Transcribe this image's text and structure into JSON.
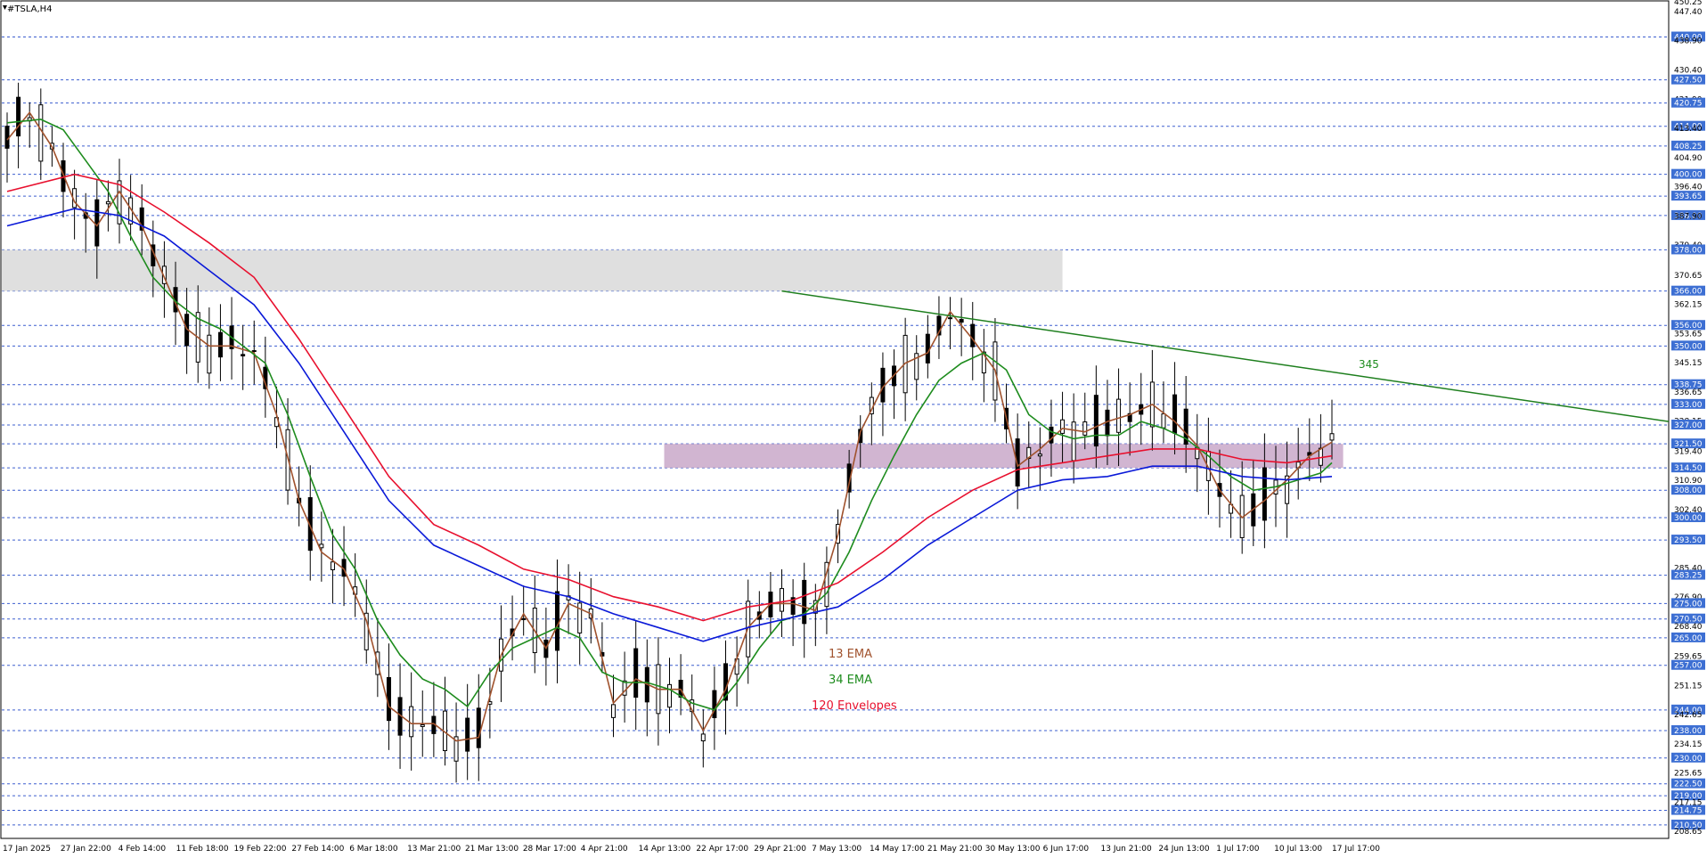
{
  "window_title": "#TSLA,H4",
  "chart_data": {
    "type": "candlestick",
    "symbol": "#TSLA",
    "timeframe": "H4",
    "ylim": [
      206.85,
      450.25
    ],
    "grid": true,
    "x_ticks": [
      "17 Jan 2025",
      "27 Jan 22:00",
      "4 Feb 14:00",
      "11 Feb 18:00",
      "19 Feb 22:00",
      "27 Feb 14:00",
      "6 Mar 18:00",
      "13 Mar 21:00",
      "21 Mar 13:00",
      "28 Mar 17:00",
      "4 Apr 21:00",
      "14 Apr 13:00",
      "22 Apr 17:00",
      "29 Apr 21:00",
      "7 May 13:00",
      "14 May 17:00",
      "21 May 21:00",
      "30 May 13:00",
      "6 Jun 17:00",
      "13 Jun 21:00",
      "24 Jun 13:00",
      "1 Jul 17:00",
      "10 Jul 13:00",
      "17 Jul 17:00"
    ],
    "y_ticks": [
      "450.25",
      "447.40",
      "440.00",
      "438.90",
      "430.40",
      "427.50",
      "421.90",
      "420.75",
      "414.00",
      "413.40",
      "408.25",
      "404.90",
      "400.00",
      "396.40",
      "393.65",
      "388.00",
      "387.90",
      "379.40",
      "378.00",
      "370.65",
      "366.00",
      "362.15",
      "356.00",
      "353.65",
      "350.00",
      "345.15",
      "338.75",
      "336.65",
      "333.00",
      "328.15",
      "327.00",
      "321.50",
      "319.40",
      "314.50",
      "310.90",
      "308.00",
      "302.40",
      "300.00",
      "293.90",
      "293.50",
      "285.40",
      "283.25",
      "276.90",
      "275.00",
      "270.50",
      "268.40",
      "265.00",
      "259.65",
      "257.00",
      "251.15",
      "244.00",
      "242.65",
      "238.00",
      "234.15",
      "230.00",
      "225.65",
      "222.50",
      "219.00",
      "217.15",
      "214.75",
      "210.50",
      "208.65"
    ],
    "level_lines": [
      440.0,
      427.5,
      420.75,
      414.0,
      408.25,
      400.0,
      393.65,
      388.0,
      378.0,
      366.0,
      356.0,
      350.0,
      338.75,
      333.0,
      327.0,
      321.5,
      314.5,
      308.0,
      300.0,
      293.5,
      283.25,
      275.0,
      270.5,
      265.0,
      257.0,
      244.0,
      238.0,
      230.0,
      222.5,
      219.0,
      214.75,
      210.5
    ],
    "series": [
      {
        "name": "13 EMA",
        "color": "#A0522D",
        "points": [
          [
            0,
            410
          ],
          [
            2,
            418
          ],
          [
            4,
            408
          ],
          [
            6,
            392
          ],
          [
            8,
            385
          ],
          [
            10,
            395
          ],
          [
            12,
            385
          ],
          [
            14,
            370
          ],
          [
            16,
            355
          ],
          [
            18,
            350
          ],
          [
            20,
            350
          ],
          [
            22,
            348
          ],
          [
            24,
            330
          ],
          [
            26,
            305
          ],
          [
            28,
            290
          ],
          [
            30,
            285
          ],
          [
            32,
            270
          ],
          [
            34,
            245
          ],
          [
            36,
            240
          ],
          [
            38,
            240
          ],
          [
            40,
            235
          ],
          [
            42,
            236
          ],
          [
            44,
            260
          ],
          [
            46,
            272
          ],
          [
            48,
            262
          ],
          [
            50,
            275
          ],
          [
            52,
            272
          ],
          [
            54,
            246
          ],
          [
            56,
            253
          ],
          [
            58,
            250
          ],
          [
            60,
            250
          ],
          [
            62,
            238
          ],
          [
            64,
            250
          ],
          [
            66,
            268
          ],
          [
            68,
            275
          ],
          [
            70,
            275
          ],
          [
            72,
            273
          ],
          [
            74,
            295
          ],
          [
            76,
            325
          ],
          [
            78,
            338
          ],
          [
            80,
            345
          ],
          [
            82,
            348
          ],
          [
            84,
            360
          ],
          [
            86,
            352
          ],
          [
            88,
            343
          ],
          [
            90,
            315
          ],
          [
            92,
            320
          ],
          [
            94,
            326
          ],
          [
            96,
            325
          ],
          [
            98,
            328
          ],
          [
            100,
            330
          ],
          [
            102,
            333
          ],
          [
            104,
            328
          ],
          [
            106,
            321
          ],
          [
            108,
            308
          ],
          [
            110,
            300
          ],
          [
            112,
            305
          ],
          [
            114,
            311
          ],
          [
            116,
            318
          ],
          [
            118,
            322
          ]
        ]
      },
      {
        "name": "34 EMA",
        "color": "#1E8C1E",
        "points": [
          [
            0,
            415
          ],
          [
            3,
            416
          ],
          [
            5,
            413
          ],
          [
            7,
            404
          ],
          [
            9,
            395
          ],
          [
            11,
            382
          ],
          [
            13,
            370
          ],
          [
            15,
            363
          ],
          [
            17,
            358
          ],
          [
            19,
            355
          ],
          [
            21,
            350
          ],
          [
            23,
            345
          ],
          [
            25,
            330
          ],
          [
            27,
            312
          ],
          [
            29,
            295
          ],
          [
            31,
            285
          ],
          [
            33,
            270
          ],
          [
            35,
            260
          ],
          [
            37,
            253
          ],
          [
            39,
            250
          ],
          [
            41,
            245
          ],
          [
            43,
            255
          ],
          [
            45,
            262
          ],
          [
            47,
            265
          ],
          [
            49,
            268
          ],
          [
            51,
            265
          ],
          [
            53,
            255
          ],
          [
            55,
            252
          ],
          [
            57,
            252
          ],
          [
            59,
            250
          ],
          [
            61,
            246
          ],
          [
            63,
            244
          ],
          [
            65,
            252
          ],
          [
            67,
            262
          ],
          [
            69,
            270
          ],
          [
            71,
            272
          ],
          [
            73,
            278
          ],
          [
            75,
            290
          ],
          [
            77,
            305
          ],
          [
            79,
            318
          ],
          [
            81,
            330
          ],
          [
            83,
            340
          ],
          [
            85,
            345
          ],
          [
            87,
            348
          ],
          [
            89,
            343
          ],
          [
            91,
            330
          ],
          [
            93,
            325
          ],
          [
            95,
            323
          ],
          [
            97,
            324
          ],
          [
            99,
            324
          ],
          [
            101,
            328
          ],
          [
            103,
            326
          ],
          [
            105,
            323
          ],
          [
            107,
            318
          ],
          [
            109,
            312
          ],
          [
            111,
            308
          ],
          [
            113,
            309
          ],
          [
            115,
            311
          ],
          [
            117,
            313
          ],
          [
            118,
            316
          ]
        ]
      },
      {
        "name": "120 Envelopes",
        "color": "#E8102E",
        "points": [
          [
            0,
            395
          ],
          [
            6,
            400
          ],
          [
            10,
            397
          ],
          [
            14,
            389
          ],
          [
            18,
            380
          ],
          [
            22,
            370
          ],
          [
            26,
            352
          ],
          [
            30,
            332
          ],
          [
            34,
            312
          ],
          [
            38,
            298
          ],
          [
            42,
            292
          ],
          [
            46,
            285
          ],
          [
            50,
            282
          ],
          [
            54,
            277
          ],
          [
            58,
            274
          ],
          [
            62,
            270
          ],
          [
            66,
            274
          ],
          [
            70,
            276
          ],
          [
            74,
            281
          ],
          [
            78,
            290
          ],
          [
            82,
            300
          ],
          [
            86,
            308
          ],
          [
            90,
            314
          ],
          [
            94,
            316
          ],
          [
            98,
            318
          ],
          [
            102,
            320
          ],
          [
            106,
            320
          ],
          [
            110,
            317
          ],
          [
            114,
            316
          ],
          [
            118,
            318
          ]
        ]
      },
      {
        "name": "",
        "color": "#0A19D8",
        "points": [
          [
            0,
            385
          ],
          [
            6,
            390
          ],
          [
            10,
            388
          ],
          [
            14,
            382
          ],
          [
            18,
            372
          ],
          [
            22,
            362
          ],
          [
            26,
            345
          ],
          [
            30,
            325
          ],
          [
            34,
            305
          ],
          [
            38,
            292
          ],
          [
            42,
            286
          ],
          [
            46,
            280
          ],
          [
            50,
            277
          ],
          [
            54,
            272
          ],
          [
            58,
            268
          ],
          [
            62,
            264
          ],
          [
            66,
            268
          ],
          [
            70,
            271
          ],
          [
            74,
            274
          ],
          [
            78,
            282
          ],
          [
            82,
            292
          ],
          [
            86,
            300
          ],
          [
            90,
            308
          ],
          [
            94,
            311
          ],
          [
            98,
            312
          ],
          [
            102,
            315
          ],
          [
            106,
            315
          ],
          [
            110,
            312
          ],
          [
            114,
            311
          ],
          [
            118,
            312
          ]
        ]
      }
    ],
    "candle_index_count": 119,
    "annotations": [
      {
        "text": "13 EMA",
        "color": "#A0522D"
      },
      {
        "text": "34 EMA",
        "color": "#1E8C1E"
      },
      {
        "text": "120 Envelopes",
        "color": "#E8102E"
      },
      {
        "text": "345",
        "color": "#1E8C1E"
      }
    ],
    "zones": [
      {
        "name": "resistance-zone",
        "from_index": 0,
        "to_index": 94,
        "y_low": 366,
        "y_high": 378,
        "color": "#D9D9D9"
      },
      {
        "name": "support-zone",
        "from_index": 59,
        "to_index": 119,
        "y_low": 314.5,
        "y_high": 321.5,
        "color": "#C9A8C9"
      }
    ],
    "trendline": {
      "from_index": 69,
      "from_y": 366,
      "to_index": 119,
      "to_y": 328,
      "color": "#1E7F1E"
    },
    "price_tag": {
      "index": 118,
      "y": 333
    }
  }
}
